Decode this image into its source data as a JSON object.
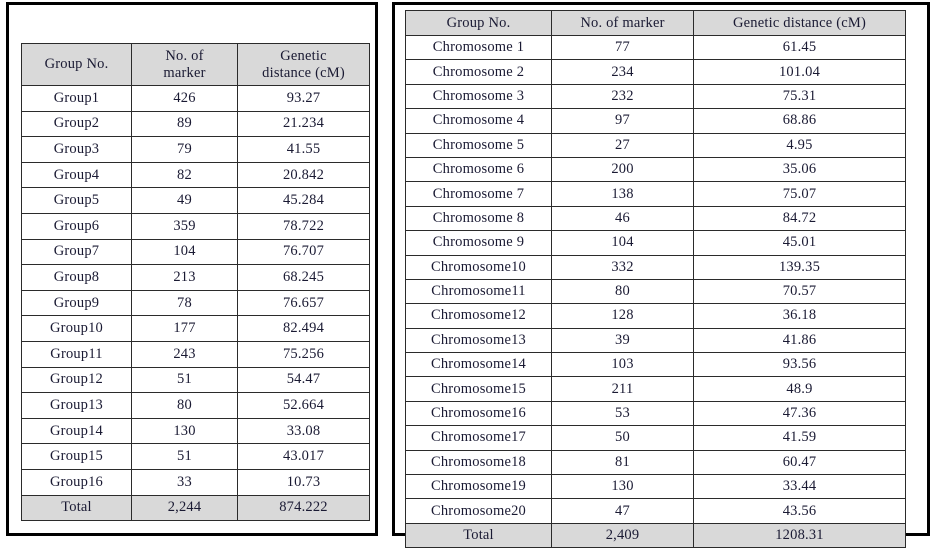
{
  "page": {
    "background_color": "#ffffff",
    "frame_color": "#000000",
    "header_fill": "#d9d9d9",
    "grid_color": "#2b2b2b",
    "text_color": "#1a1a33"
  },
  "left_panel": {
    "table": {
      "headers": {
        "col1": "Group  No.",
        "col2_line1": "No.  of",
        "col2_line2": "marker",
        "col3_line1": "Genetic",
        "col3_line2": "distance (cM)"
      },
      "rows": [
        {
          "group": "Group1",
          "markers": "426",
          "distance": "93.27"
        },
        {
          "group": "Group2",
          "markers": "89",
          "distance": "21.234"
        },
        {
          "group": "Group3",
          "markers": "79",
          "distance": "41.55"
        },
        {
          "group": "Group4",
          "markers": "82",
          "distance": "20.842"
        },
        {
          "group": "Group5",
          "markers": "49",
          "distance": "45.284"
        },
        {
          "group": "Group6",
          "markers": "359",
          "distance": "78.722"
        },
        {
          "group": "Group7",
          "markers": "104",
          "distance": "76.707"
        },
        {
          "group": "Group8",
          "markers": "213",
          "distance": "68.245"
        },
        {
          "group": "Group9",
          "markers": "78",
          "distance": "76.657"
        },
        {
          "group": "Group10",
          "markers": "177",
          "distance": "82.494"
        },
        {
          "group": "Group11",
          "markers": "243",
          "distance": "75.256"
        },
        {
          "group": "Group12",
          "markers": "51",
          "distance": "54.47"
        },
        {
          "group": "Group13",
          "markers": "80",
          "distance": "52.664"
        },
        {
          "group": "Group14",
          "markers": "130",
          "distance": "33.08"
        },
        {
          "group": "Group15",
          "markers": "51",
          "distance": "43.017"
        },
        {
          "group": "Group16",
          "markers": "33",
          "distance": "10.73"
        }
      ],
      "total": {
        "group": "Total",
        "markers": "2,244",
        "distance": "874.222"
      }
    }
  },
  "right_panel": {
    "table": {
      "headers": {
        "col1": "Group  No.",
        "col2": "No.  of  marker",
        "col3": "Genetic  distance (cM)"
      },
      "rows": [
        {
          "group": "Chromosome 1",
          "markers": "77",
          "distance": "61.45"
        },
        {
          "group": "Chromosome 2",
          "markers": "234",
          "distance": "101.04"
        },
        {
          "group": "Chromosome 3",
          "markers": "232",
          "distance": "75.31"
        },
        {
          "group": "Chromosome 4",
          "markers": "97",
          "distance": "68.86"
        },
        {
          "group": "Chromosome 5",
          "markers": "27",
          "distance": "4.95"
        },
        {
          "group": "Chromosome 6",
          "markers": "200",
          "distance": "35.06"
        },
        {
          "group": "Chromosome 7",
          "markers": "138",
          "distance": "75.07"
        },
        {
          "group": "Chromosome 8",
          "markers": "46",
          "distance": "84.72"
        },
        {
          "group": "Chromosome 9",
          "markers": "104",
          "distance": "45.01"
        },
        {
          "group": "Chromosome10",
          "markers": "332",
          "distance": "139.35"
        },
        {
          "group": "Chromosome11",
          "markers": "80",
          "distance": "70.57"
        },
        {
          "group": "Chromosome12",
          "markers": "128",
          "distance": "36.18"
        },
        {
          "group": "Chromosome13",
          "markers": "39",
          "distance": "41.86"
        },
        {
          "group": "Chromosome14",
          "markers": "103",
          "distance": "93.56"
        },
        {
          "group": "Chromosome15",
          "markers": "211",
          "distance": "48.9"
        },
        {
          "group": "Chromosome16",
          "markers": "53",
          "distance": "47.36"
        },
        {
          "group": "Chromosome17",
          "markers": "50",
          "distance": "41.59"
        },
        {
          "group": "Chromosome18",
          "markers": "81",
          "distance": "60.47"
        },
        {
          "group": "Chromosome19",
          "markers": "130",
          "distance": "33.44"
        },
        {
          "group": "Chromosome20",
          "markers": "47",
          "distance": "43.56"
        }
      ],
      "total": {
        "group": "Total",
        "markers": "2,409",
        "distance": "1208.31"
      }
    }
  }
}
